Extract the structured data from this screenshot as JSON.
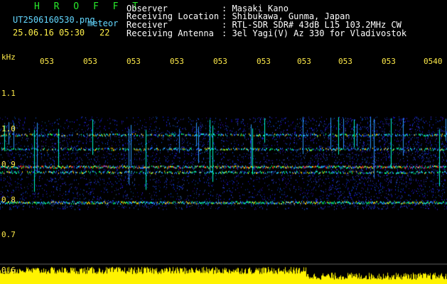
{
  "header": {
    "station": "H R O F F T",
    "filename": "UT2506160530.png",
    "meteor_label": "meteor",
    "datetime": "25.06.16 05:30",
    "count": "22",
    "observer_label": "Observer",
    "observer_value": ": Masaki Kano",
    "location_label": "Receiving Location",
    "location_value": ": Shibukawa, Gunma, Japan",
    "receiver_label": "Receiver",
    "receiver_value": ": RTL-SDR SDR# 43dB L15 103.2MHz CW",
    "antenna_label": "Receiving Antenna",
    "antenna_value": ": 3el Yagi(V) Az 330 for Vladivostok"
  },
  "axis": {
    "unit": "kHz",
    "x_ticks": [
      "053",
      "053",
      "053",
      "053",
      "053",
      "053",
      "053",
      "053",
      "053",
      "0540"
    ],
    "y_ticks": [
      "1.1",
      "1.0",
      "0.9",
      "0.8",
      "0.7",
      "0.6"
    ]
  },
  "chart_data": {
    "type": "heatmap",
    "title": "",
    "ylabel": "kHz",
    "ylim": [
      0.6,
      1.1
    ],
    "bands_khz": [
      0.98,
      0.94,
      0.89,
      0.875,
      0.79
    ],
    "colors": {
      "background": "#000000",
      "noise": "#1a2bff",
      "signal_strong": "#ff2a2a",
      "text_yellow": "#fff04a",
      "text_cyan": "#63d7ff",
      "text_green": "#29e82b"
    }
  }
}
